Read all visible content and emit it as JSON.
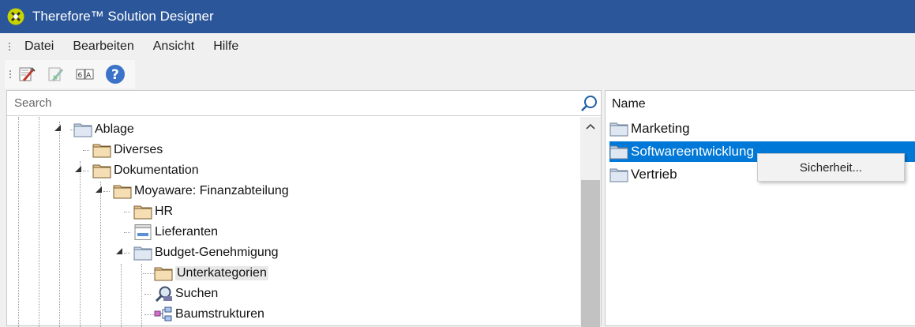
{
  "window": {
    "title": "Therefore™ Solution Designer"
  },
  "menu": {
    "items": [
      "Datei",
      "Bearbeiten",
      "Ansicht",
      "Hilfe"
    ]
  },
  "toolbar": {
    "buttons": [
      "edit-icon",
      "disabled-edit-icon",
      "rename-icon",
      "help-icon"
    ]
  },
  "search": {
    "placeholder": "Search"
  },
  "tree": {
    "nodes": [
      {
        "label": "Ablage",
        "icon": "folder-blue-icon",
        "state": "open"
      },
      {
        "label": "Diverses",
        "icon": "folder-tan-icon",
        "state": "closed"
      },
      {
        "label": "Dokumentation",
        "icon": "folder-tan-icon",
        "state": "open"
      },
      {
        "label": "Moyaware: Finanzabteilung",
        "icon": "folder-tan-icon",
        "state": "open"
      },
      {
        "label": "HR",
        "icon": "folder-tan-icon",
        "state": "closed"
      },
      {
        "label": "Lieferanten",
        "icon": "form-icon",
        "state": "closed"
      },
      {
        "label": "Budget-Genehmigung",
        "icon": "folder-blue-icon",
        "state": "open"
      },
      {
        "label": "Unterkategorien",
        "icon": "folder-tan-icon",
        "state": "none"
      },
      {
        "label": "Suchen",
        "icon": "search-query-icon",
        "state": "closed"
      },
      {
        "label": "Baumstrukturen",
        "icon": "tree-structure-icon",
        "state": "none"
      }
    ]
  },
  "list": {
    "header": "Name",
    "items": [
      "Marketing",
      "Softwareentwicklung",
      "Vertrieb"
    ],
    "selected_index": 1
  },
  "context_menu": {
    "items": [
      "Sicherheit..."
    ]
  },
  "colors": {
    "titlebar": "#2b579a",
    "selection": "#0078d7"
  }
}
